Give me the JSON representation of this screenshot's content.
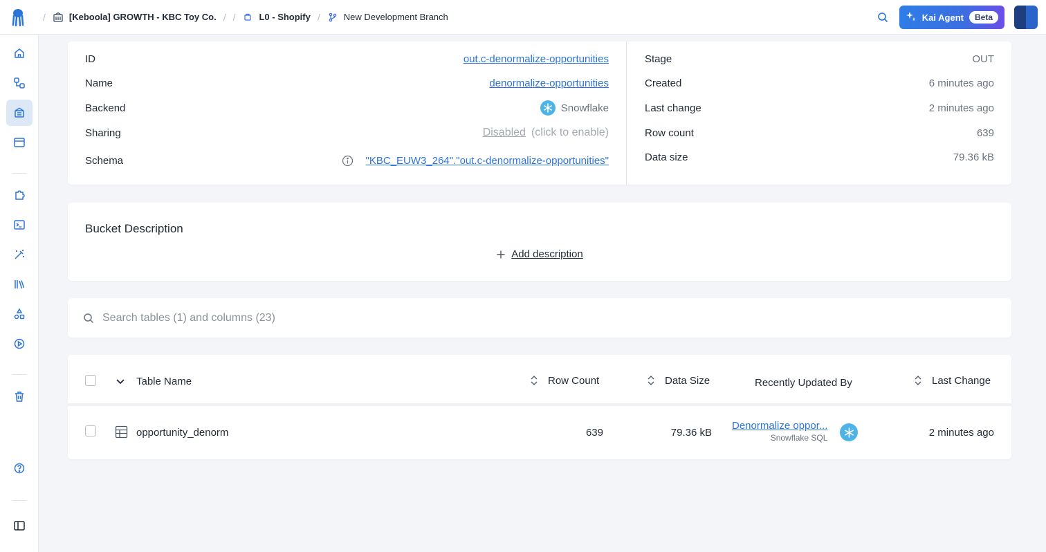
{
  "breadcrumbs": {
    "project": "[Keboola] GROWTH - KBC Toy Co.",
    "bucket": "L0 - Shopify",
    "branch": "New Development Branch"
  },
  "kai": {
    "label": "Kai Agent",
    "badge": "Beta"
  },
  "details": {
    "left": [
      {
        "label": "ID",
        "value": "out.c-denormalize-opportunities"
      },
      {
        "label": "Name",
        "value": "denormalize-opportunities"
      },
      {
        "label": "Backend",
        "value": "Snowflake"
      },
      {
        "label": "Sharing",
        "value": "Disabled",
        "hint": "(click to enable)"
      },
      {
        "label": "Schema",
        "value": "\"KBC_EUW3_264\".\"out.c-denormalize-opportunities\""
      }
    ],
    "right": [
      {
        "label": "Stage",
        "value": "OUT"
      },
      {
        "label": "Created",
        "value": "6 minutes ago"
      },
      {
        "label": "Last change",
        "value": "2 minutes ago"
      },
      {
        "label": "Row count",
        "value": "639"
      },
      {
        "label": "Data size",
        "value": "79.36 kB"
      }
    ]
  },
  "description": {
    "title": "Bucket Description",
    "add_label": "Add description"
  },
  "search": {
    "placeholder": "Search tables (1) and columns (23)"
  },
  "table": {
    "headers": {
      "name": "Table Name",
      "rows": "Row Count",
      "size": "Data Size",
      "updated_by": "Recently Updated By",
      "last_change": "Last Change"
    },
    "rows": [
      {
        "name": "opportunity_denorm",
        "row_count": "639",
        "data_size": "79.36 kB",
        "updated_by": "Denormalize oppor...",
        "updated_by_type": "Snowflake SQL",
        "last_change": "2 minutes ago"
      }
    ]
  },
  "colors": {
    "accent": "#2d74da",
    "snowflake": "#4eb3e6"
  }
}
